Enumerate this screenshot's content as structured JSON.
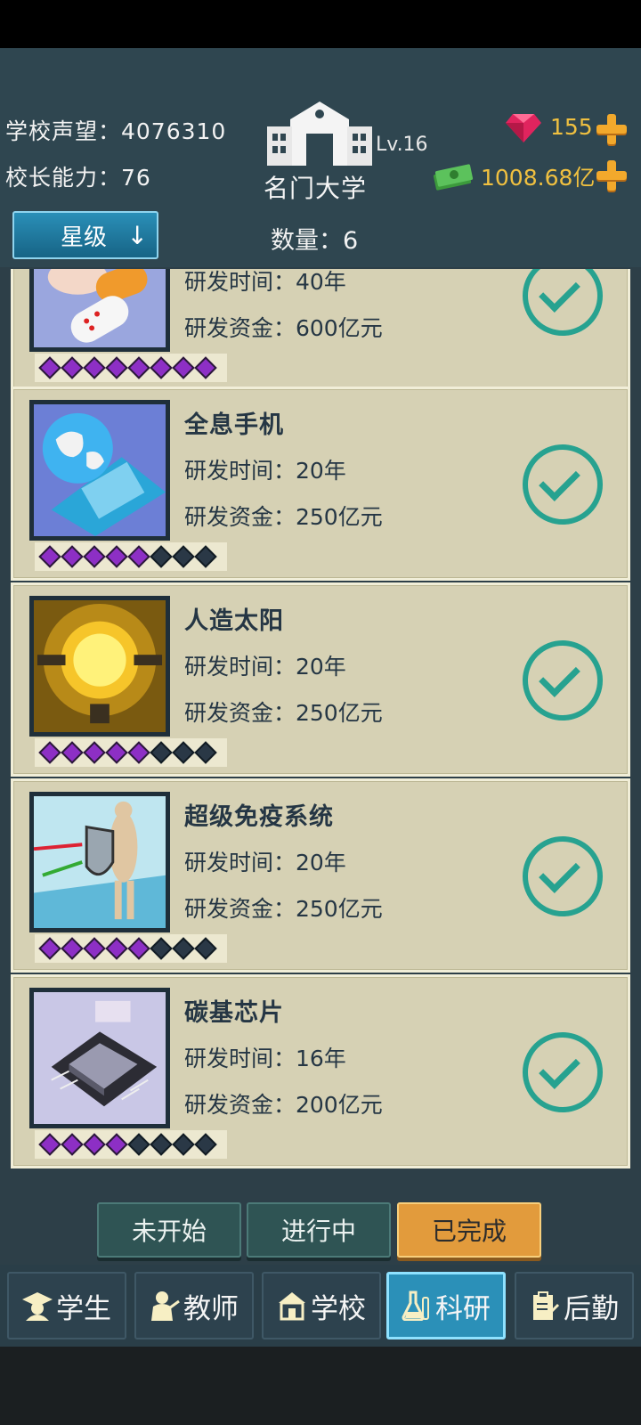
{
  "header": {
    "reputation": "学校声望：4076310",
    "ability": "校长能力：76",
    "level": "Lv.16",
    "school_name": "名门大学",
    "gems": "155",
    "money": "1008.68亿"
  },
  "controls": {
    "sort_label": "星级",
    "sort_arrow": "↓",
    "count": "数量：6"
  },
  "items": [
    {
      "title": "",
      "time": "研发时间：40年",
      "cost": "研发资金：600亿元",
      "stars_on": 8,
      "stars_total": 8,
      "completed": true
    },
    {
      "title": "全息手机",
      "time": "研发时间：20年",
      "cost": "研发资金：250亿元",
      "stars_on": 5,
      "stars_total": 8,
      "completed": true
    },
    {
      "title": "人造太阳",
      "time": "研发时间：20年",
      "cost": "研发资金：250亿元",
      "stars_on": 5,
      "stars_total": 8,
      "completed": true
    },
    {
      "title": "超级免疫系统",
      "time": "研发时间：20年",
      "cost": "研发资金：250亿元",
      "stars_on": 5,
      "stars_total": 8,
      "completed": true
    },
    {
      "title": "碳基芯片",
      "time": "研发时间：16年",
      "cost": "研发资金：200亿元",
      "stars_on": 4,
      "stars_total": 8,
      "completed": true
    }
  ],
  "status_tabs": [
    "未开始",
    "进行中",
    "已完成"
  ],
  "nav": [
    "学生",
    "教师",
    "学校",
    "科研",
    "后勤"
  ],
  "colors": {
    "accent": "#27a290",
    "gold": "#f0c040",
    "active_tab": "#e29b3c",
    "nav_active": "#2b90b8"
  }
}
